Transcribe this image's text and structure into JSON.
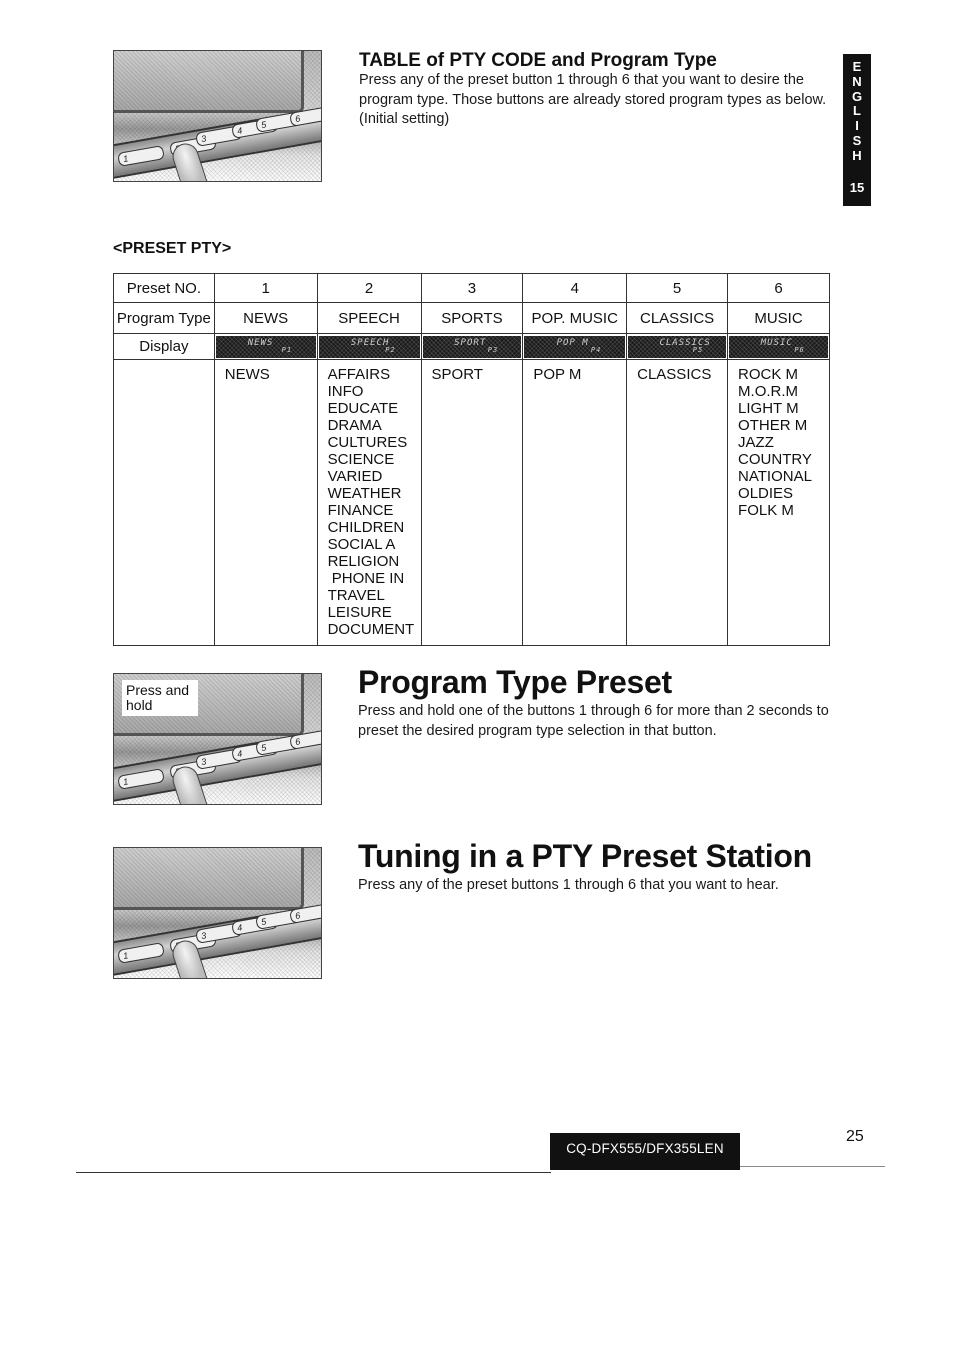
{
  "side_tab": {
    "letters": [
      "E",
      "N",
      "G",
      "L",
      "I",
      "S",
      "H"
    ],
    "section_number": "15"
  },
  "illustrations": {
    "buttons": [
      "1",
      "2",
      "3",
      "4",
      "5",
      "6"
    ],
    "press_label": "Press and hold"
  },
  "table_section": {
    "title": "TABLE of PTY CODE and Program Type",
    "description": "Press any of the preset button 1 through 6 that you want to desire the program type. Those buttons are already stored program types as below. (Initial setting)"
  },
  "preset_pty": {
    "heading": "<PRESET PTY>",
    "row_headers": {
      "preset_no": "Preset NO.",
      "program_type": "Program Type",
      "display": "Display"
    },
    "columns": [
      {
        "preset": "1",
        "program_type": "NEWS",
        "display": "NEWS",
        "display_ch": "P1",
        "codes": [
          "NEWS"
        ]
      },
      {
        "preset": "2",
        "program_type": "SPEECH",
        "display": "SPEECH",
        "display_ch": "P2",
        "codes": [
          "AFFAIRS",
          "INFO",
          "EDUCATE",
          "DRAMA",
          "CULTURES",
          "SCIENCE",
          "VARIED",
          "WEATHER",
          "FINANCE",
          "CHILDREN",
          "SOCIAL A",
          "RELIGION",
          " PHONE IN",
          "TRAVEL",
          "LEISURE",
          "DOCUMENT"
        ]
      },
      {
        "preset": "3",
        "program_type": "SPORTS",
        "display": "SPORT",
        "display_ch": "P3",
        "codes": [
          "SPORT"
        ]
      },
      {
        "preset": "4",
        "program_type": "POP. MUSIC",
        "display": "POP  M",
        "display_ch": "P4",
        "codes": [
          "POP M"
        ]
      },
      {
        "preset": "5",
        "program_type": "CLASSICS",
        "display": "CLASSICS",
        "display_ch": "P5",
        "codes": [
          "CLASSICS"
        ]
      },
      {
        "preset": "6",
        "program_type": "MUSIC",
        "display": "MUSIC",
        "display_ch": "P6",
        "codes": [
          "ROCK M",
          "M.O.R.M",
          "LIGHT M",
          "OTHER M",
          "JAZZ",
          "COUNTRY",
          "NATIONAL",
          "OLDIES",
          "FOLK M"
        ]
      }
    ]
  },
  "program_type_preset": {
    "title": "Program Type Preset",
    "description": "Press and hold one of the buttons 1 through 6 for more than 2 seconds to preset the desired program type selection in that button."
  },
  "tuning_section": {
    "title": "Tuning in a PTY Preset Station",
    "description": "Press any of the preset buttons 1 through 6 that you want to hear."
  },
  "footer": {
    "model": "CQ-DFX555/DFX355LEN",
    "page_number": "25"
  }
}
